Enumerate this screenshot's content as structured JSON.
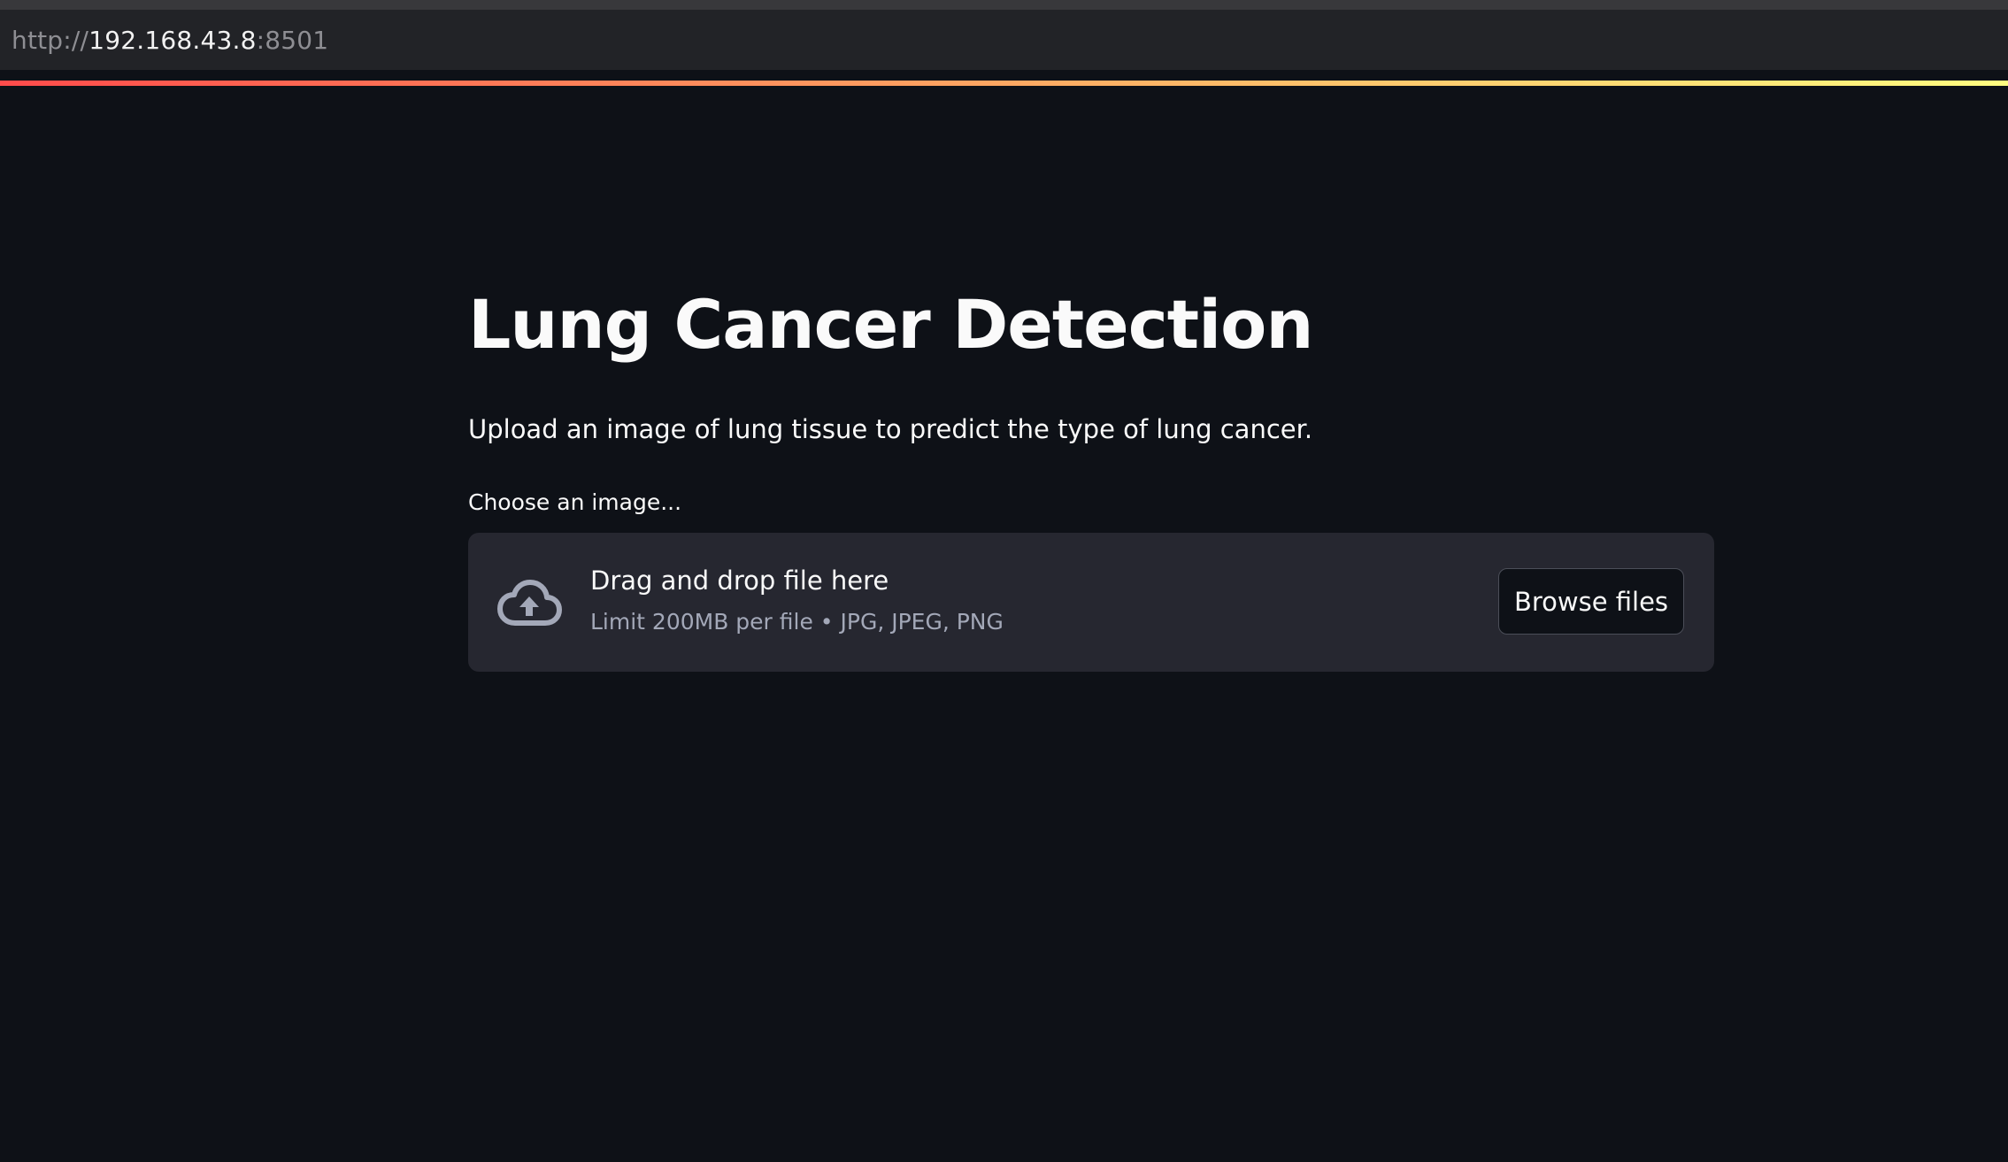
{
  "browser": {
    "url_scheme": "http://",
    "url_host": "192.168.43.8",
    "url_port": ":8501"
  },
  "app": {
    "title": "Lung Cancer Detection",
    "description": "Upload an image of lung tissue to predict the type of lung cancer.",
    "uploader": {
      "label": "Choose an image...",
      "drop_instructions": "Drag and drop file here",
      "limit_text": "Limit 200MB per file • JPG, JPEG, PNG",
      "browse_label": "Browse files",
      "icon": "cloud-upload-icon"
    }
  },
  "colors": {
    "background": "#0e1117",
    "dropzone": "#262730",
    "accent_gradient": [
      "#ff4b4b",
      "#fdb165",
      "#fffd80"
    ]
  }
}
